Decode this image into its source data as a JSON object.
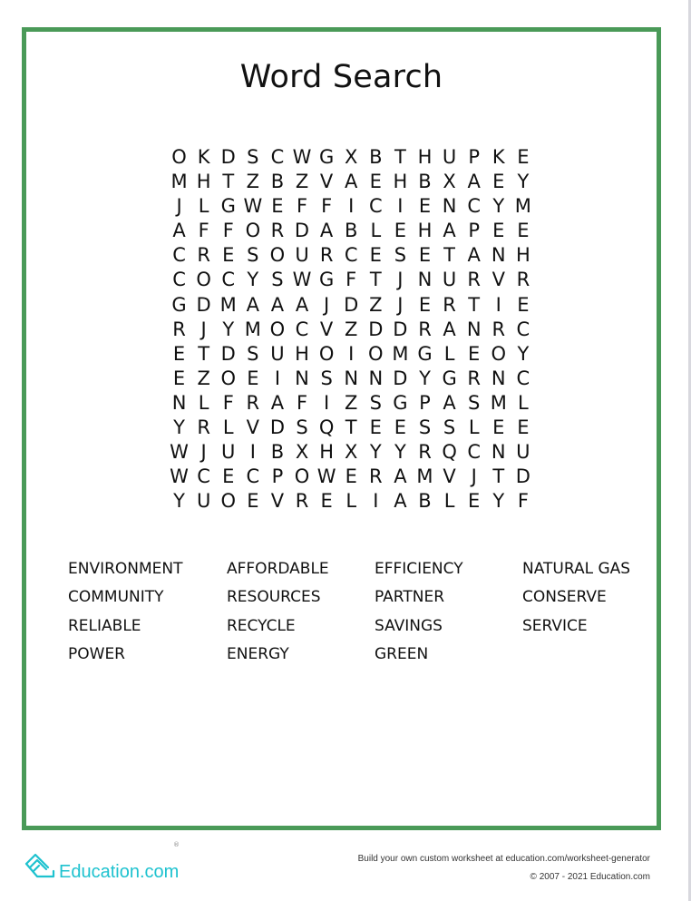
{
  "worksheet": {
    "title": "Word Search",
    "grid": [
      [
        "O",
        "K",
        "D",
        "S",
        "C",
        "W",
        "G",
        "X",
        "B",
        "T",
        "H",
        "U",
        "P",
        "K",
        "E"
      ],
      [
        "M",
        "H",
        "T",
        "Z",
        "B",
        "Z",
        "V",
        "A",
        "E",
        "H",
        "B",
        "X",
        "A",
        "E",
        "Y"
      ],
      [
        "J",
        "L",
        "G",
        "W",
        "E",
        "F",
        "F",
        "I",
        "C",
        "I",
        "E",
        "N",
        "C",
        "Y",
        "M"
      ],
      [
        "A",
        "F",
        "F",
        "O",
        "R",
        "D",
        "A",
        "B",
        "L",
        "E",
        "H",
        "A",
        "P",
        "E",
        "E"
      ],
      [
        "C",
        "R",
        "E",
        "S",
        "O",
        "U",
        "R",
        "C",
        "E",
        "S",
        "E",
        "T",
        "A",
        "N",
        "H"
      ],
      [
        "C",
        "O",
        "C",
        "Y",
        "S",
        "W",
        "G",
        "F",
        "T",
        "J",
        "N",
        "U",
        "R",
        "V",
        "R"
      ],
      [
        "G",
        "D",
        "M",
        "A",
        "A",
        "A",
        "J",
        "D",
        "Z",
        "J",
        "E",
        "R",
        "T",
        "I",
        "E"
      ],
      [
        "R",
        "J",
        "Y",
        "M",
        "O",
        "C",
        "V",
        "Z",
        "D",
        "D",
        "R",
        "A",
        "N",
        "R",
        "C"
      ],
      [
        "E",
        "T",
        "D",
        "S",
        "U",
        "H",
        "O",
        "I",
        "O",
        "M",
        "G",
        "L",
        "E",
        "O",
        "Y"
      ],
      [
        "E",
        "Z",
        "O",
        "E",
        "I",
        "N",
        "S",
        "N",
        "N",
        "D",
        "Y",
        "G",
        "R",
        "N",
        "C"
      ],
      [
        "N",
        "L",
        "F",
        "R",
        "A",
        "F",
        "I",
        "Z",
        "S",
        "G",
        "P",
        "A",
        "S",
        "M",
        "L"
      ],
      [
        "Y",
        "R",
        "L",
        "V",
        "D",
        "S",
        "Q",
        "T",
        "E",
        "E",
        "S",
        "S",
        "L",
        "E",
        "E"
      ],
      [
        "W",
        "J",
        "U",
        "I",
        "B",
        "X",
        "H",
        "X",
        "Y",
        "Y",
        "R",
        "Q",
        "C",
        "N",
        "U"
      ],
      [
        "W",
        "C",
        "E",
        "C",
        "P",
        "O",
        "W",
        "E",
        "R",
        "A",
        "M",
        "V",
        "J",
        "T",
        "D"
      ],
      [
        "Y",
        "U",
        "O",
        "E",
        "V",
        "R",
        "E",
        "L",
        "I",
        "A",
        "B",
        "L",
        "E",
        "Y",
        "F"
      ]
    ],
    "word_list": [
      "ENVIRONMENT",
      "AFFORDABLE",
      "EFFICIENCY",
      "NATURAL GAS",
      "COMMUNITY",
      "RESOURCES",
      "PARTNER",
      "CONSERVE",
      "RELIABLE",
      "RECYCLE",
      "SAVINGS",
      "SERVICE",
      "POWER",
      "ENERGY",
      "GREEN"
    ]
  },
  "footer": {
    "brand": "Education.com",
    "registered_mark": "®",
    "tagline": "Build your own custom worksheet at education.com/worksheet-generator",
    "copyright": "© 2007 - 2021 Education.com"
  },
  "colors": {
    "frame": "#4a9a58",
    "brand": "#1ec2cf"
  }
}
